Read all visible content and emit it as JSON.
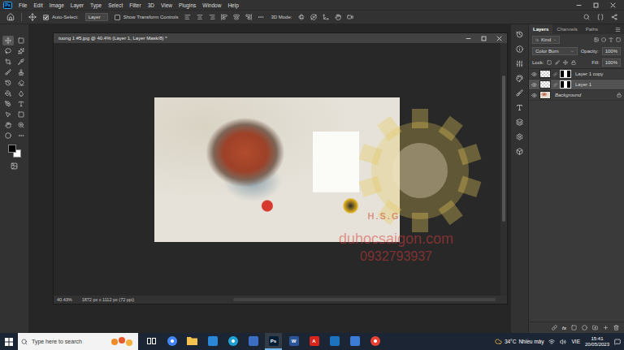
{
  "app": {
    "badge": "Ps"
  },
  "menu": [
    "File",
    "Edit",
    "Image",
    "Layer",
    "Type",
    "Select",
    "Filter",
    "3D",
    "View",
    "Plugins",
    "Window",
    "Help"
  ],
  "options_bar": {
    "auto_select_label": "Auto-Select:",
    "auto_select_checked": true,
    "target": "Layer",
    "transform_label": "Show Transform Controls",
    "transform_checked": false,
    "mode_label": "3D Mode:"
  },
  "tools": [
    {
      "selected": true
    },
    {
      "selected": false
    },
    {
      "selected": false
    },
    {
      "selected": false
    },
    {
      "selected": false
    },
    {
      "selected": false
    },
    {
      "selected": false
    },
    {
      "selected": false
    },
    {
      "selected": false
    },
    {
      "selected": false
    },
    {
      "selected": false
    },
    {
      "selected": false
    },
    {
      "selected": false
    },
    {
      "selected": false
    },
    {
      "selected": false
    },
    {
      "selected": false
    },
    {
      "selected": false
    },
    {
      "selected": false
    },
    {
      "selected": false
    },
    {
      "selected": false
    }
  ],
  "document": {
    "title": "tuong 1 #5.jpg @ 40.4% (Layer 1, Layer Mask/8) *",
    "zoom": "40.43%",
    "info": "1872 px x 1112 px (72 ppi)"
  },
  "watermark": {
    "brand": "H.S.G",
    "site": "duhocsaigon.com",
    "phone": "0932793937"
  },
  "panel_tabs": [
    {
      "label": "Layers",
      "selected": true
    },
    {
      "label": "Channels",
      "selected": false
    },
    {
      "label": "Paths",
      "selected": false
    }
  ],
  "layer_controls": {
    "filter": "Kind",
    "blend": "Color Burn",
    "opacity_label": "Opacity:",
    "opacity": "100%",
    "lock_label": "Lock:",
    "fill_label": "Fill:",
    "fill": "100%"
  },
  "layers": [
    {
      "name": "Layer 1 copy",
      "selected": false,
      "visible": true,
      "has_mask": true,
      "locked": false,
      "italic": false
    },
    {
      "name": "Layer 1",
      "selected": true,
      "visible": true,
      "has_mask": true,
      "locked": false,
      "italic": false
    },
    {
      "name": "Background",
      "selected": false,
      "visible": true,
      "has_mask": false,
      "locked": true,
      "italic": true
    }
  ],
  "layer_footer": {
    "fx": "fx"
  },
  "taskbar": {
    "search_placeholder": "Type here to search",
    "weather_temp": "34°C",
    "weather_text": "Nhiều mây",
    "language": "VIE",
    "time": "15:41",
    "date": "20/05/2023"
  },
  "taskbar_apps": [
    {
      "kind": "task-view",
      "label": "",
      "color": "#ffffff",
      "selected": false
    },
    {
      "kind": "round",
      "label": "",
      "color": "#4285f4",
      "selected": false
    },
    {
      "kind": "folder",
      "label": "",
      "color": "#f2c14e",
      "selected": false
    },
    {
      "kind": "tile",
      "label": "",
      "color": "#2b88d8",
      "selected": false
    },
    {
      "kind": "round",
      "label": "",
      "color": "#1fa2d6",
      "selected": false
    },
    {
      "kind": "tile",
      "label": "",
      "color": "#3a6fc4",
      "selected": false
    },
    {
      "kind": "tile",
      "label": "Ps",
      "color": "#001e36",
      "selected": true
    },
    {
      "kind": "tile",
      "label": "W",
      "color": "#2b579a",
      "selected": false
    },
    {
      "kind": "tile",
      "label": "A",
      "color": "#d9261c",
      "selected": false
    },
    {
      "kind": "tile",
      "label": "",
      "color": "#1e73be",
      "selected": false
    },
    {
      "kind": "tile",
      "label": "",
      "color": "#3b7dd8",
      "selected": false
    },
    {
      "kind": "round",
      "label": "",
      "color": "#e94235",
      "selected": false
    }
  ]
}
